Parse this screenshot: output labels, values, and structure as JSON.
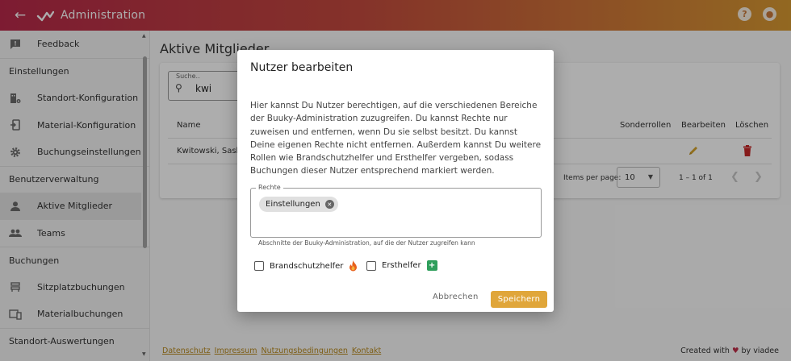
{
  "header": {
    "title": "Administration",
    "back_icon": "arrow-left-icon",
    "help_icon": "help-icon",
    "account_icon": "account-icon"
  },
  "sidebar": {
    "items": [
      {
        "type": "item",
        "label": "Feedback",
        "icon": "feedback-icon"
      },
      {
        "type": "section",
        "label": "Einstellungen"
      },
      {
        "type": "item",
        "label": "Standort-Konfiguration",
        "icon": "building-gear-icon"
      },
      {
        "type": "item",
        "label": "Material-Konfiguration",
        "icon": "phone-import-icon"
      },
      {
        "type": "item",
        "label": "Buchungseinstellungen",
        "icon": "gear-icon"
      },
      {
        "type": "section",
        "label": "Benutzerverwaltung"
      },
      {
        "type": "item",
        "label": "Aktive Mitglieder",
        "icon": "person-icon",
        "active": true
      },
      {
        "type": "item",
        "label": "Teams",
        "icon": "group-icon"
      },
      {
        "type": "section",
        "label": "Buchungen"
      },
      {
        "type": "item",
        "label": "Sitzplatzbuchungen",
        "icon": "seat-icon"
      },
      {
        "type": "item",
        "label": "Materialbuchungen",
        "icon": "devices-icon"
      },
      {
        "type": "section",
        "label": "Standort-Auswertungen"
      }
    ]
  },
  "main": {
    "title": "Aktive Mitglieder",
    "search": {
      "label": "Suche..",
      "value": "kwi"
    },
    "table": {
      "columns": {
        "name": "Name",
        "special_roles": "Sonderrollen",
        "edit": "Bearbeiten",
        "delete": "Löschen"
      },
      "rows": [
        {
          "name": "Kwitowski, Saskia"
        }
      ]
    },
    "pagination": {
      "items_per_page_label": "Items per page:",
      "items_per_page": "10",
      "range": "1 – 1 of 1"
    }
  },
  "footer": {
    "links": [
      "Datenschutz",
      "Impressum",
      "Nutzungsbedingungen",
      "Kontakt"
    ],
    "credit_prefix": "Created with",
    "credit_suffix": "by viadee"
  },
  "dialog": {
    "title": "Nutzer bearbeiten",
    "text": "Hier kannst Du Nutzer berechtigen, auf die verschiedenen Bereiche der Buuky-Administration zuzugreifen. Du kannst Rechte nur zuweisen und entfernen, wenn Du sie selbst besitzt. Du kannst Deine eigenen Rechte nicht entfernen. Außerdem kannst Du weitere Rollen wie Brandschutzhelfer und Ersthelfer vergeben, sodass Buchungen dieser Nutzer entsprechend markiert werden.",
    "rights_label": "Rechte",
    "rights_chips": [
      "Einstellungen"
    ],
    "rights_hint": "Abschnitte der Buuky-Administration, auf die der Nutzer zugreifen kann",
    "fire_helper_label": "Brandschutzhelfer",
    "first_aid_label": "Ersthelfer",
    "cancel_label": "Abbrechen",
    "save_label": "Speichern"
  },
  "colors": {
    "accent": "#e0a63a",
    "brand_start": "#b8294a",
    "brand_end": "#d89a32",
    "delete": "#c62828",
    "first_aid": "#2e9e5b"
  }
}
